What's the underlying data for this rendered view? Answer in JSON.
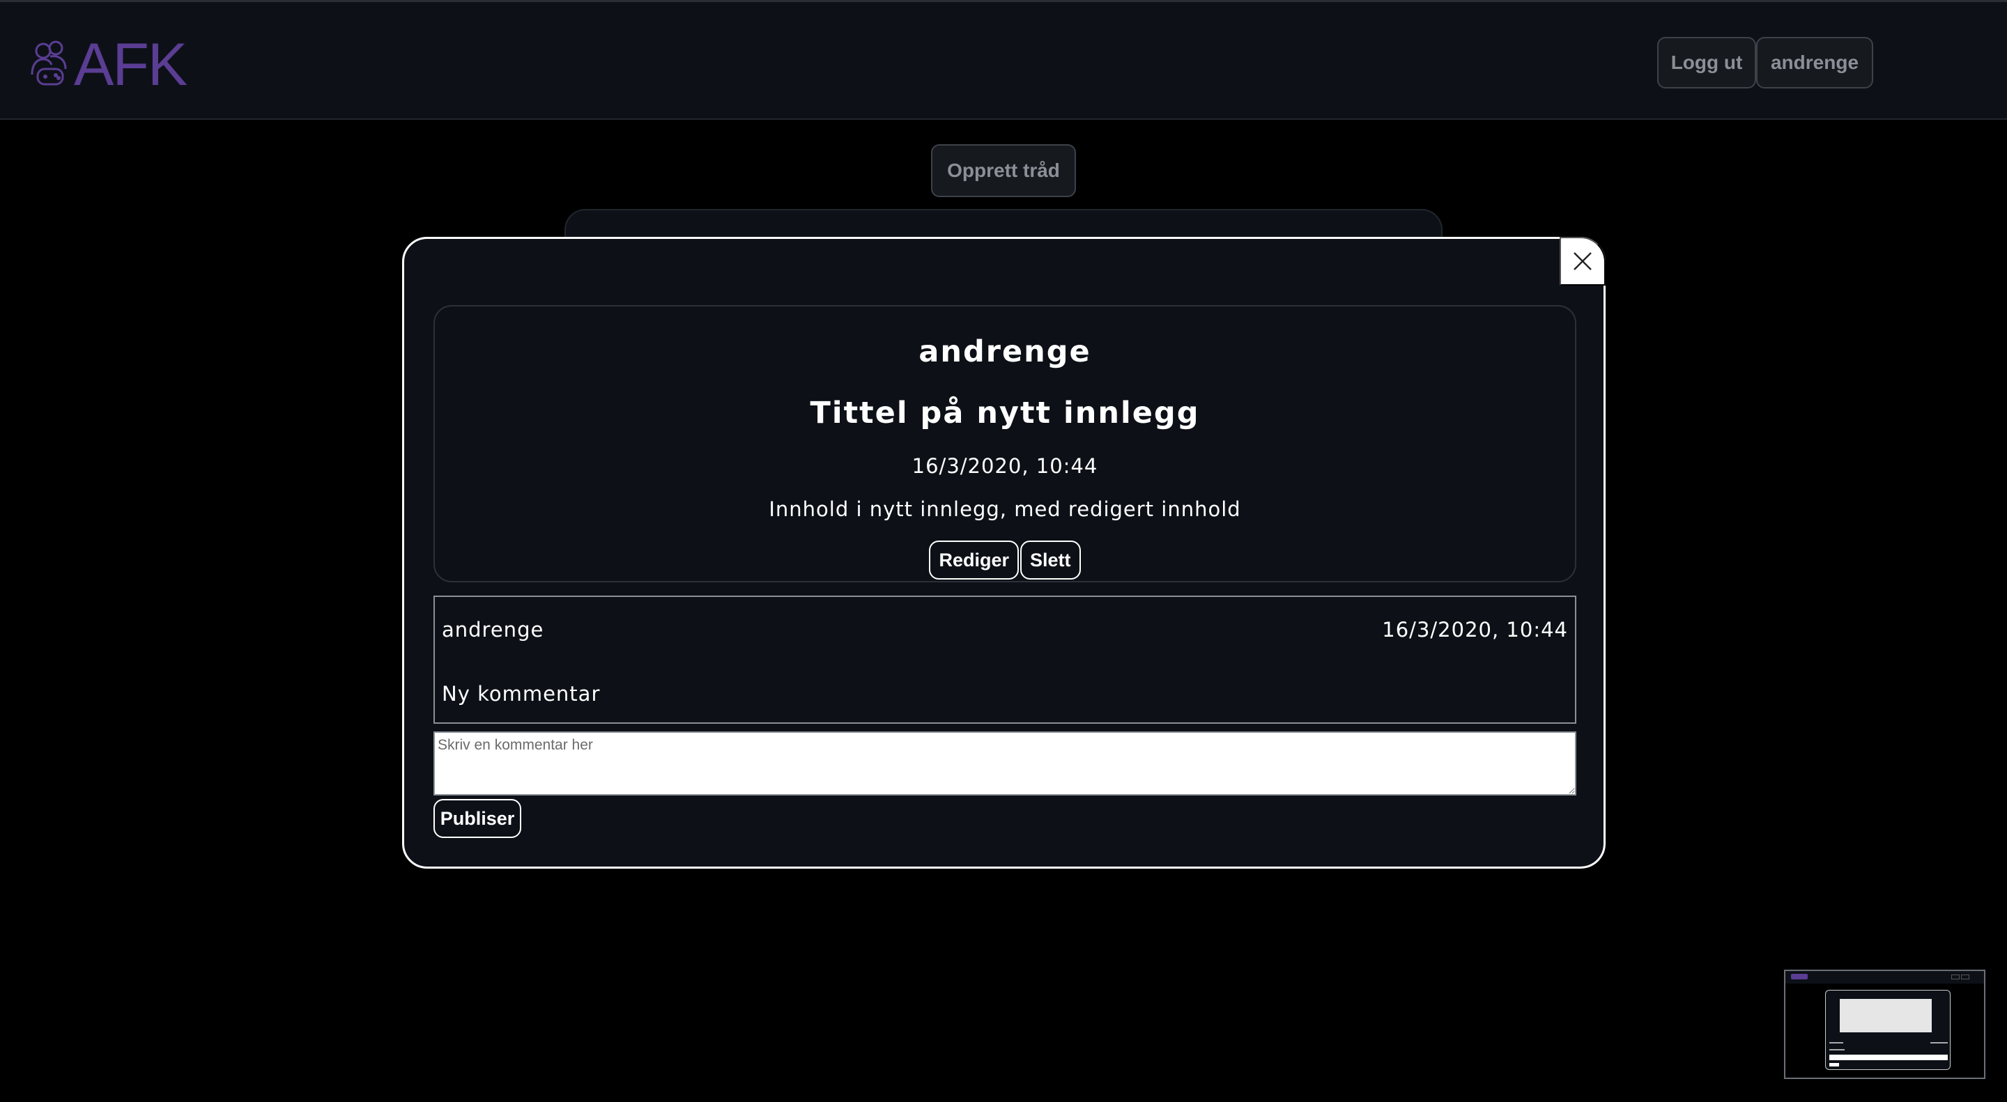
{
  "header": {
    "logo_text": "AFK",
    "logout_label": "Logg ut",
    "user_label": "andrenge"
  },
  "main": {
    "create_thread_label": "Opprett tråd"
  },
  "modal": {
    "post": {
      "author": "andrenge",
      "title": "Tittel på nytt innlegg",
      "date": "16/3/2020, 10:44",
      "content": "Innhold i nytt innlegg, med redigert innhold",
      "edit_label": "Rediger",
      "delete_label": "Slett"
    },
    "comments": [
      {
        "author": "andrenge",
        "date": "16/3/2020, 10:44",
        "text": "Ny kommentar"
      }
    ],
    "comment_input": {
      "placeholder": "Skriv en kommentar her",
      "value": ""
    },
    "publish_label": "Publiser"
  },
  "colors": {
    "background": "#000000",
    "surface": "#0d1117",
    "brand": "#5b3d94",
    "muted_text": "#8b9098"
  },
  "icons": {
    "logo": "gamers-logo-icon",
    "close": "close-icon"
  }
}
